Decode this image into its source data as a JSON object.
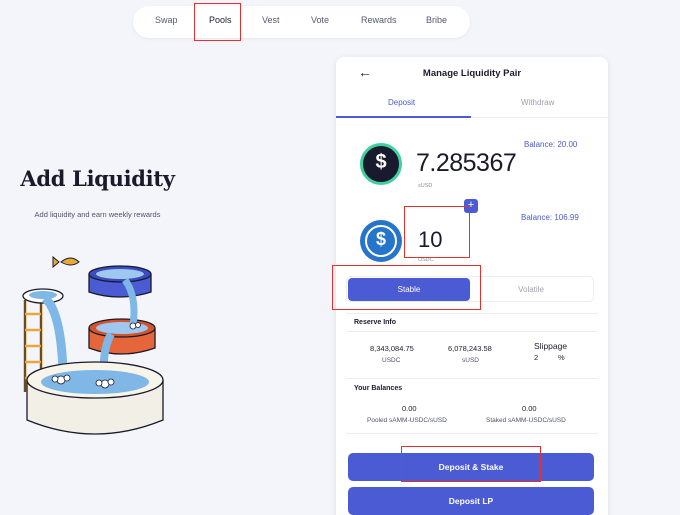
{
  "nav": {
    "items": [
      "Swap",
      "Pools",
      "Vest",
      "Vote",
      "Rewards",
      "Bribe"
    ],
    "active": "Pools"
  },
  "hero": {
    "title": "Add Liquidity",
    "subtitle": "Add liquidity and earn weekly rewards"
  },
  "card": {
    "title": "Manage Liquidity Pair",
    "tabs": {
      "deposit": "Deposit",
      "withdraw": "Withdraw"
    },
    "token1": {
      "balance": "Balance: 20.00",
      "amount": "7.285367",
      "symbol": "sUSD",
      "icon_glyph": "$"
    },
    "token2": {
      "balance": "Balance: 106.99",
      "amount": "10",
      "symbol": "USDC",
      "icon_glyph": "$",
      "add_glyph": "+"
    },
    "pool_type": {
      "stable": "Stable",
      "volatile": "Volatile",
      "selected": "Stable"
    },
    "reserve": {
      "label": "Reserve Info",
      "usdc_value": "8,343,084.75",
      "usdc_label": "USDC",
      "susd_value": "6,078,243.58",
      "susd_label": "sUSD",
      "slippage_label": "Slippage",
      "slippage_value": "2",
      "slippage_unit": "%"
    },
    "balances": {
      "label": "Your Balances",
      "pooled_value": "0.00",
      "pooled_label": "Pooled sAMM-USDC/sUSD",
      "staked_value": "0.00",
      "staked_label": "Staked sAMM-USDC/sUSD"
    },
    "buttons": {
      "deposit_stake": "Deposit & Stake",
      "deposit_lp": "Deposit LP"
    }
  },
  "colors": {
    "accent": "#4a5bd4",
    "background": "#f4f5fb",
    "highlight": "#e0332e",
    "susd_icon": "#1a1a2e",
    "susd_ring": "#3fd0a0",
    "usdc_icon": "#2775ca"
  },
  "icons": {
    "back": "arrow-left-icon",
    "token1": "susd-token-icon",
    "token2": "usdc-token-icon",
    "add": "plus-icon"
  }
}
